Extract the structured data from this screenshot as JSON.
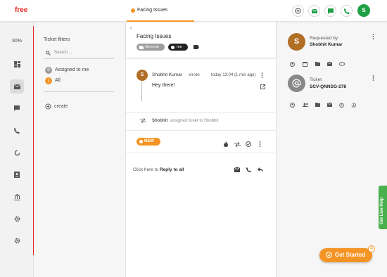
{
  "app": {
    "logo": "free"
  },
  "tab": {
    "title": "Facing Issues"
  },
  "topbar": {
    "actions": [
      "add-circle-icon",
      "mail-icon",
      "chat-icon",
      "phone-icon"
    ],
    "user_initial": "S",
    "accent": "#f39424",
    "user_color": "#1fa046"
  },
  "rail": {
    "percent": "30%",
    "items": [
      "dashboard-icon",
      "mail-icon",
      "chat-icon",
      "phone-icon",
      "loop-icon",
      "contacts-icon",
      "bank-icon",
      "settings-icon",
      "settings-icon"
    ]
  },
  "filters": {
    "title": "Ticket filters",
    "search_placeholder": "Search ...",
    "items": [
      {
        "label": "Assigned to me",
        "count": "0",
        "color": "#9e9e9e"
      },
      {
        "label": "All",
        "count": "1",
        "color": "#f39424"
      }
    ],
    "create_label": "create"
  },
  "ticket": {
    "back": "‹",
    "title": "Facing Issues",
    "tags": [
      {
        "label": "General",
        "color": "#9e9e9e"
      },
      {
        "label": "me",
        "color": "#222222"
      }
    ],
    "message": {
      "avatar_initial": "S",
      "author": "Shobhit Kumar",
      "verb": "wrote",
      "time": "today 13:04 (1 min ago)",
      "body": "Hey there!"
    },
    "activity": {
      "user": "Shobhit",
      "text": "assigned ticket to Shobhit"
    },
    "status": "NEW",
    "reply": {
      "prefix": "Click here to",
      "link": "Reply to all"
    }
  },
  "right": {
    "requester": {
      "initial": "S",
      "label": "Requested by",
      "name": "Shobhit Kumar"
    },
    "ticket_info": {
      "label": "Ticket",
      "id": "SCV-QNNSG-278"
    }
  },
  "widgets": {
    "live_help": "Get Live Help",
    "get_started": "Get Started",
    "get_started_count": "4"
  }
}
